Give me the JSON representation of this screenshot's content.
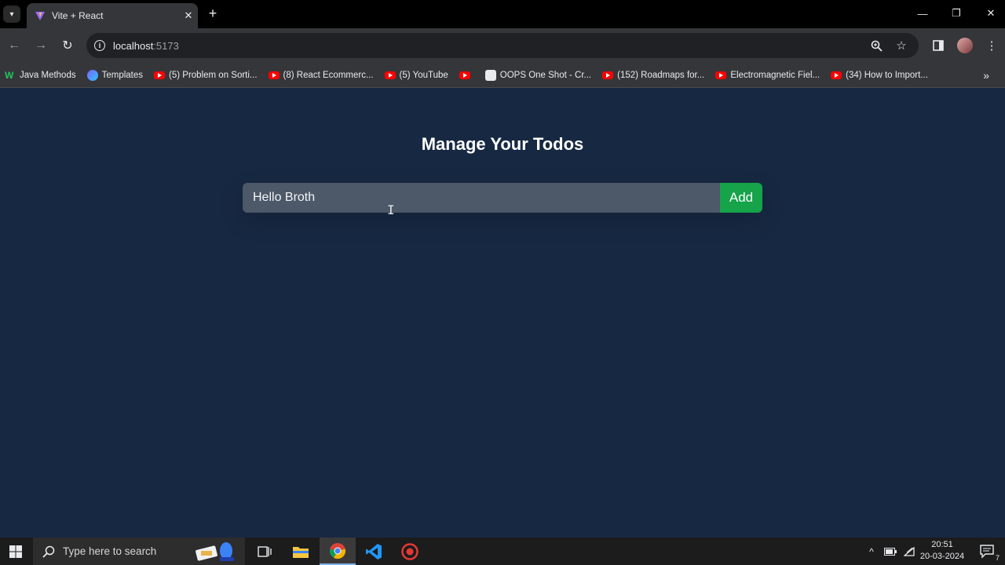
{
  "browser": {
    "tab": {
      "title": "Vite + React",
      "close": "✕"
    },
    "new_tab": "+",
    "window_controls": {
      "minimize": "—",
      "restore": "❐",
      "close": "✕"
    },
    "url": {
      "host": "localhost",
      "port": ":5173"
    },
    "bookmarks": [
      {
        "label": "Java Methods",
        "icon": "java-methods-icon",
        "kind": "jm"
      },
      {
        "label": "Templates",
        "icon": "templates-icon",
        "kind": "tp"
      },
      {
        "label": "(5) Problem on Sorti...",
        "icon": "youtube-icon",
        "kind": "yt"
      },
      {
        "label": "(8) React Ecommerc...",
        "icon": "youtube-icon",
        "kind": "yt"
      },
      {
        "label": "(5) YouTube",
        "icon": "youtube-icon",
        "kind": "yt"
      },
      {
        "label": "",
        "icon": "youtube-icon",
        "kind": "yt"
      },
      {
        "label": "OOPS One Shot - Cr...",
        "icon": "github-icon",
        "kind": "gh"
      },
      {
        "label": "(152) Roadmaps for...",
        "icon": "youtube-icon",
        "kind": "yt"
      },
      {
        "label": "Electromagnetic Fiel...",
        "icon": "youtube-icon",
        "kind": "yt"
      },
      {
        "label": "(34) How to Import...",
        "icon": "youtube-icon",
        "kind": "yt"
      }
    ],
    "bookmarks_more": "»"
  },
  "app": {
    "title": "Manage Your Todos",
    "input_value": "Hello Broth",
    "add_label": "Add",
    "colors": {
      "background": "#172842",
      "input_bg": "#4d5868",
      "add_button": "#16a34a"
    }
  },
  "taskbar": {
    "search_placeholder": "Type here to search",
    "time": "20:51",
    "date": "20-03-2024",
    "notification_count": "7"
  }
}
